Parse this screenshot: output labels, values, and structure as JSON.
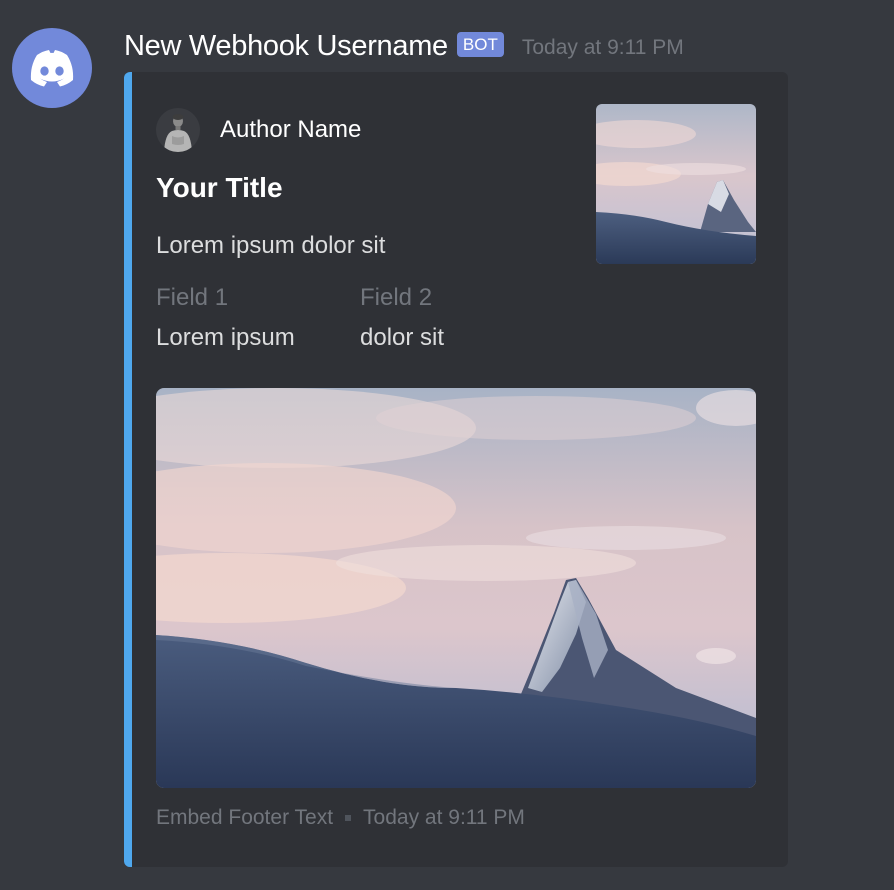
{
  "webhook": {
    "username": "New Webhook Username",
    "bot_tag": "BOT",
    "timestamp": "Today at 9:11 PM",
    "avatar_icon": "discord-logo-icon"
  },
  "embed": {
    "color": "#4fa8ee",
    "author": {
      "name": "Author Name"
    },
    "title": "Your Title",
    "description": "Lorem ipsum dolor sit",
    "fields": [
      {
        "name": "Field 1",
        "value": "Lorem ipsum"
      },
      {
        "name": "Field 2",
        "value": "dolor sit"
      }
    ],
    "footer": {
      "text": "Embed Footer Text",
      "timestamp": "Today at 9:11 PM"
    }
  },
  "colors": {
    "background": "#36393f",
    "embed_background": "#2f3136",
    "blurple": "#7289da"
  }
}
